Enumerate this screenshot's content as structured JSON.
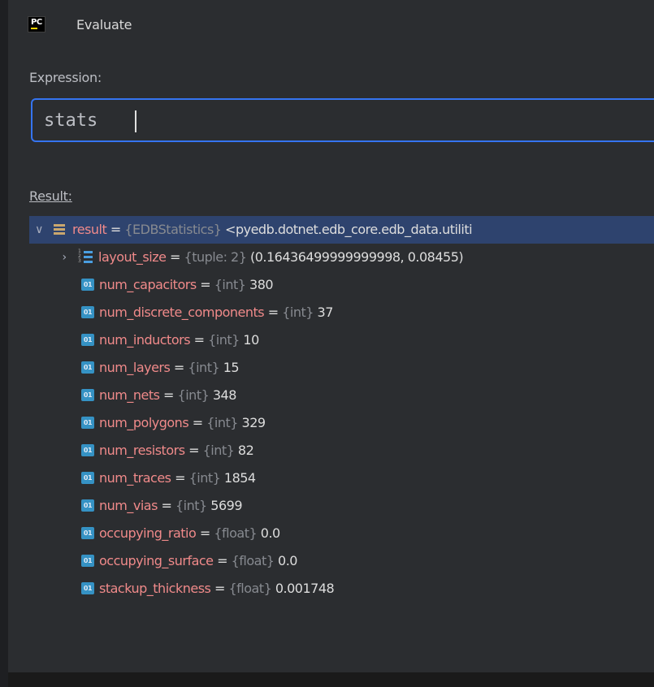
{
  "dialog": {
    "app_icon_text": "PC",
    "title": "Evaluate"
  },
  "expression": {
    "label": "Expression:",
    "value": "stats"
  },
  "result": {
    "label": "Result:",
    "root": {
      "name": "result",
      "eq": " = ",
      "type": "{EDBStatistics}",
      "value": " <pyedb.dotnet.edb_core.edb_data.utiliti"
    },
    "children": [
      {
        "name": "layout_size",
        "eq": " = ",
        "type": "{tuple: 2}",
        "value": " (0.16436499999999998, 0.08455)",
        "icon": "tuple-icon"
      },
      {
        "name": "num_capacitors",
        "eq": " = ",
        "type": "{int}",
        "value": " 380",
        "icon": "int-icon"
      },
      {
        "name": "num_discrete_components",
        "eq": " = ",
        "type": "{int}",
        "value": " 37",
        "icon": "int-icon"
      },
      {
        "name": "num_inductors",
        "eq": " = ",
        "type": "{int}",
        "value": " 10",
        "icon": "int-icon"
      },
      {
        "name": "num_layers",
        "eq": " = ",
        "type": "{int}",
        "value": " 15",
        "icon": "int-icon"
      },
      {
        "name": "num_nets",
        "eq": " = ",
        "type": "{int}",
        "value": " 348",
        "icon": "int-icon"
      },
      {
        "name": "num_polygons",
        "eq": " = ",
        "type": "{int}",
        "value": " 329",
        "icon": "int-icon"
      },
      {
        "name": "num_resistors",
        "eq": " = ",
        "type": "{int}",
        "value": " 82",
        "icon": "int-icon"
      },
      {
        "name": "num_traces",
        "eq": " = ",
        "type": "{int}",
        "value": " 1854",
        "icon": "int-icon"
      },
      {
        "name": "num_vias",
        "eq": " = ",
        "type": "{int}",
        "value": " 5699",
        "icon": "int-icon"
      },
      {
        "name": "occupying_ratio",
        "eq": " = ",
        "type": "{float}",
        "value": " 0.0",
        "icon": "int-icon"
      },
      {
        "name": "occupying_surface",
        "eq": " = ",
        "type": "{float}",
        "value": " 0.0",
        "icon": "int-icon"
      },
      {
        "name": "stackup_thickness",
        "eq": " = ",
        "type": "{float}",
        "value": " 0.001748",
        "icon": "int-icon"
      }
    ],
    "int_icon_text": "01"
  },
  "colors": {
    "background": "#2b2d30",
    "selection": "#2e436e",
    "focus_border": "#3574f0",
    "name": "#f08a8a",
    "type": "#878a90"
  }
}
